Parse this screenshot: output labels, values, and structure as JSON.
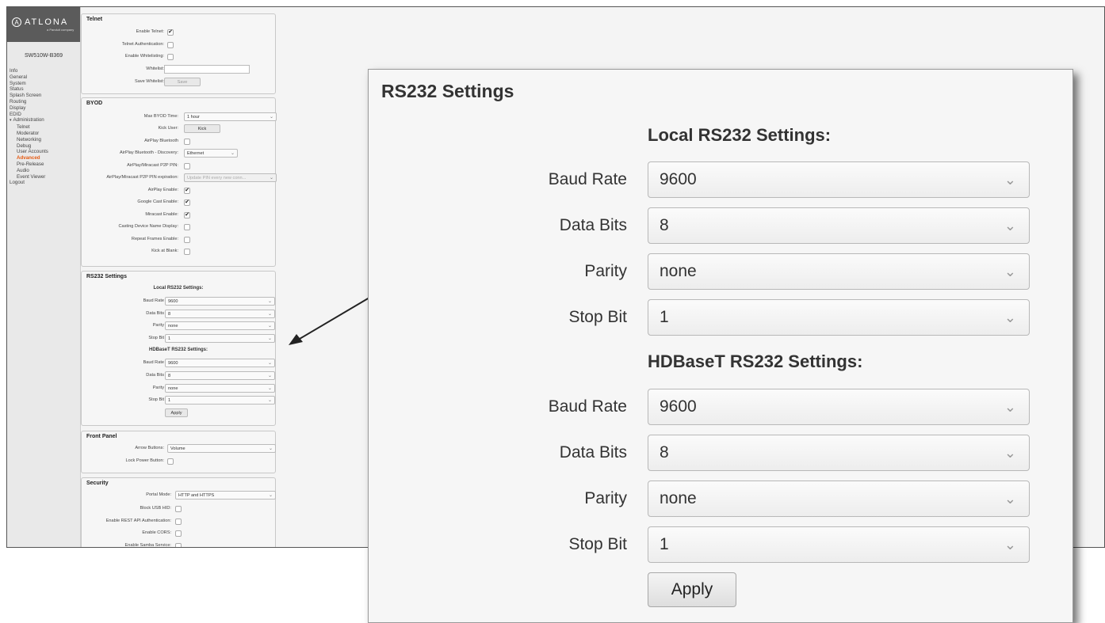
{
  "sidebar": {
    "logo_mark": "A",
    "logo_text": "ATLONA",
    "logo_sub": "a Panduit company",
    "device_name": "SW510W-B369",
    "items": {
      "info": "Info",
      "general": "General",
      "system": "System",
      "status": "Status",
      "splash": "Splash Screen",
      "routing": "Routing",
      "display": "Display",
      "edid": "EDID",
      "administration": "Administration",
      "telnet": "Telnet",
      "moderator": "Moderator",
      "networking": "Networking",
      "debug": "Debug",
      "user_accounts": "User Accounts",
      "advanced": "Advanced",
      "pre_release": "Pre-Release",
      "audio": "Audio",
      "event_viewer": "Event Viewer",
      "logout": "Logout"
    },
    "caret": "▾"
  },
  "telnet": {
    "title": "Telnet",
    "enable_telnet": "Enable Telnet:",
    "telnet_auth": "Telnet Authentication:",
    "enable_whitelisting": "Enable Whitelisting:",
    "whitelist": "Whitelist:",
    "save_whitelist": "Save Whitelist:",
    "save_button": "Save"
  },
  "byod": {
    "title": "BYOD",
    "max_time_label": "Max BYOD Time:",
    "max_time_value": "1 hour",
    "kick_user_label": "Kick User:",
    "kick_button": "Kick",
    "airplay_bluetooth": "AirPlay Bluetooth",
    "airplay_bt_discovery_label": "AirPlay Bluetooth - Discovery:",
    "airplay_bt_discovery_value": "Ethernet",
    "p2p_pin": "AirPlay/Miracast P2P PIN:",
    "p2p_pin_exp_label": "AirPlay/Miracast P2P PIN expiration:",
    "p2p_pin_exp_value": "Update PIN every new conn...",
    "airplay_enable": "AirPlay Enable:",
    "google_cast_enable": "Google Cast Enable:",
    "miracast_enable": "Miracast Enable:",
    "casting_name_display": "Casting Device Name Display:",
    "repeat_frames": "Repeat Frames Enable:",
    "kick_at_blank": "Kick at Blank:"
  },
  "rs232": {
    "title": "RS232 Settings",
    "local_heading": "Local RS232 Settings:",
    "hdbaset_heading": "HDBaseT RS232 Settings:",
    "baud_label": "Baud Rate",
    "data_bits_label": "Data Bits",
    "parity_label": "Parity",
    "stop_bit_label": "Stop Bit",
    "local": {
      "baud": "9600",
      "data_bits": "8",
      "parity": "none",
      "stop_bit": "1"
    },
    "hdbaset": {
      "baud": "9600",
      "data_bits": "8",
      "parity": "none",
      "stop_bit": "1"
    },
    "apply_button": "Apply"
  },
  "front_panel": {
    "title": "Front Panel",
    "arrow_buttons_label": "Arrow Buttons:",
    "arrow_buttons_value": "Volume",
    "lock_power_label": "Lock Power Button:"
  },
  "security": {
    "title": "Security",
    "portal_mode_label": "Portal Mode:",
    "portal_mode_value": "HTTP and HTTPS",
    "block_usb_hid": "Block USB HID:",
    "rest_api_auth": "Enable REST API Authentication:",
    "enable_cors": "Enable CORS:",
    "samba": "Enable Samba Service:"
  },
  "icons": {
    "check": "✔",
    "chevron": "⌄"
  },
  "checkbox_states": {
    "enable_telnet": true,
    "airplay_enable": true,
    "google_cast_enable": true,
    "miracast_enable": true
  },
  "colors": {
    "accent": "#e55b13",
    "logo_bar": "#5b5b5b"
  }
}
